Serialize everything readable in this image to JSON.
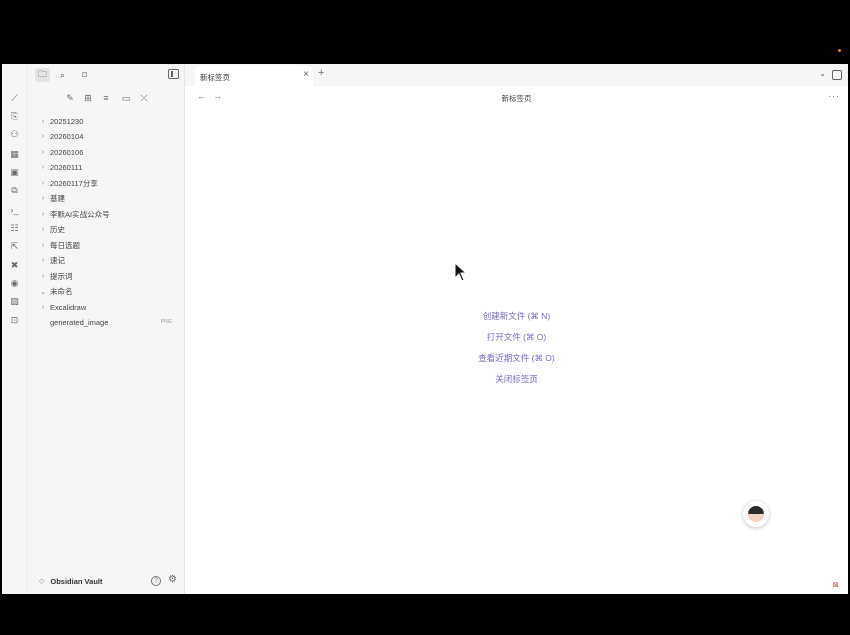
{
  "sidebar": {
    "vault_name": "Obsidian Vault",
    "tree": [
      {
        "label": "20251230",
        "type": "folder",
        "expanded": false
      },
      {
        "label": "20260104",
        "type": "folder",
        "expanded": false
      },
      {
        "label": "20260106",
        "type": "folder",
        "expanded": false
      },
      {
        "label": "20260111",
        "type": "folder",
        "expanded": false
      },
      {
        "label": "20260117分享",
        "type": "folder",
        "expanded": false
      },
      {
        "label": "基建",
        "type": "folder",
        "expanded": false
      },
      {
        "label": "李默AI实战公众号",
        "type": "folder",
        "expanded": false
      },
      {
        "label": "历史",
        "type": "folder",
        "expanded": false
      },
      {
        "label": "每日选题",
        "type": "folder",
        "expanded": false
      },
      {
        "label": "速记",
        "type": "folder",
        "expanded": false
      },
      {
        "label": "提示词",
        "type": "folder",
        "expanded": false
      },
      {
        "label": "未命名",
        "type": "folder",
        "expanded": true
      },
      {
        "label": "Excalidraw",
        "type": "folder",
        "expanded": false
      },
      {
        "label": "generated_image",
        "type": "file",
        "badge": "PNG"
      }
    ],
    "icons": {
      "files_tab": "folder-icon",
      "search_tab": "search-icon",
      "bookmarks_tab": "bookmark-icon"
    }
  },
  "tabs": [
    {
      "title": "新标签页",
      "active": true
    }
  ],
  "view": {
    "title": "新标签页",
    "actions": [
      "创建新文件 (⌘ N)",
      "打开文件 (⌘ O)",
      "查看近期文件 (⌘ O)",
      "关闭标签页"
    ]
  },
  "colors": {
    "accent": "#7a6bc4",
    "sidebar_bg": "#f6f6f6",
    "frame": "#000000"
  }
}
